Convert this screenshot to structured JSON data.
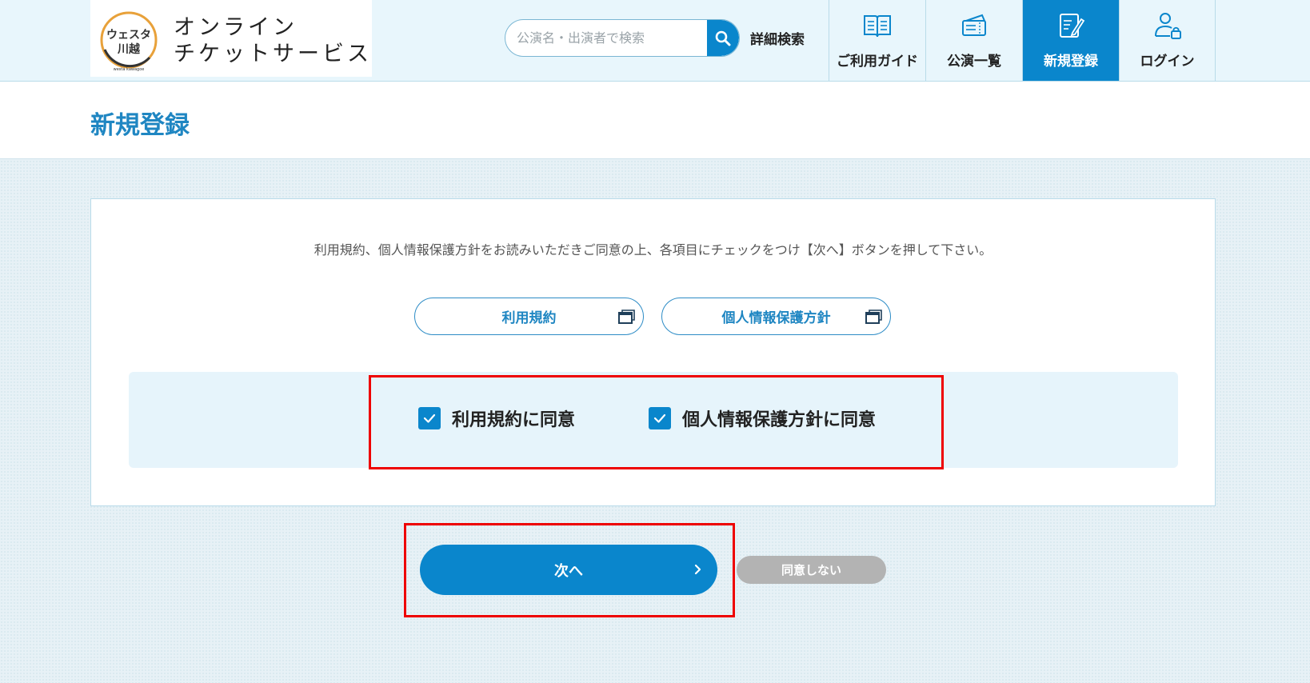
{
  "brand": {
    "logo_line1": "ウェスタ",
    "logo_line2": "川越",
    "logo_sub": "westa kawagoe",
    "name": "オンライン\nチケットサービス"
  },
  "search": {
    "placeholder": "公演名・出演者で検索",
    "value": "",
    "advanced_label": "詳細検索"
  },
  "nav": [
    {
      "label": "ご利用ガイド",
      "icon": "book-icon",
      "active": false
    },
    {
      "label": "公演一覧",
      "icon": "ticket-icon",
      "active": false
    },
    {
      "label": "新規登録",
      "icon": "edit-document-icon",
      "active": true
    },
    {
      "label": "ログイン",
      "icon": "user-lock-icon",
      "active": false
    }
  ],
  "page": {
    "title": "新規登録"
  },
  "card": {
    "instruction": "利用規約、個人情報保護方針をお読みいただきご同意の上、各項目にチェックをつけ【次へ】ボタンを押して下さい。",
    "terms_button": "利用規約",
    "privacy_button": "個人情報保護方針",
    "agree_terms": {
      "label": "利用規約に同意",
      "checked": true
    },
    "agree_privacy": {
      "label": "個人情報保護方針に同意",
      "checked": true
    }
  },
  "actions": {
    "next_label": "次へ",
    "decline_label": "同意しない"
  },
  "colors": {
    "primary": "#0a86cc",
    "header_bg": "#e8f6fc",
    "highlight": "#ee0000",
    "disabled": "#b3b3b3"
  }
}
